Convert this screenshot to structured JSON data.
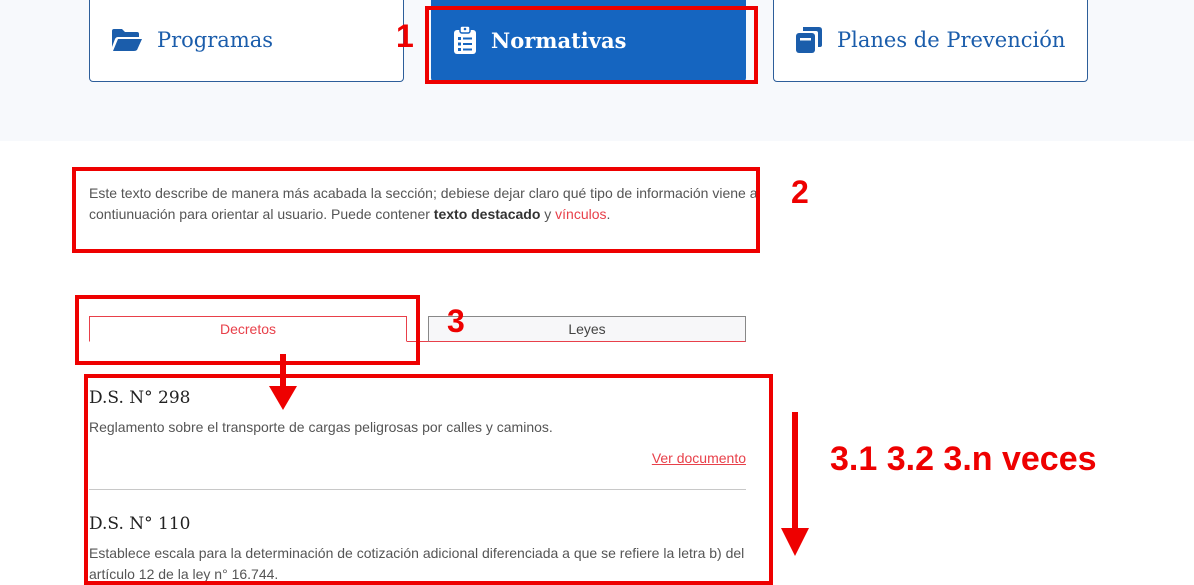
{
  "nav": {
    "items": [
      {
        "label": "Programas",
        "icon": "folder-open-icon"
      },
      {
        "label": "Normativas",
        "icon": "clipboard-list-icon",
        "active": true
      },
      {
        "label": "Planes de Prevención",
        "icon": "copy-icon"
      }
    ]
  },
  "intro": {
    "text_before": "Este texto describe de manera más acabada la sección; debiese dejar claro qué tipo de información viene a contiunuación para orientar al usuario. Puede contener ",
    "strong": "texto destacado",
    "text_middle": " y ",
    "link": "vínculos",
    "text_after": "."
  },
  "tabs": [
    {
      "label": "Decretos",
      "active": true
    },
    {
      "label": "Leyes",
      "active": false
    }
  ],
  "documents": [
    {
      "title": "D.S. N° 298",
      "description": "Reglamento sobre el transporte de cargas peligrosas por calles y caminos.",
      "link": "Ver documento"
    },
    {
      "title": "D.S. N° 110",
      "description": "Establece escala para la determinación de cotización adicional diferenciada a que se refiere la letra b) del artículo 12 de la ley n° 16.744."
    }
  ],
  "annotations": {
    "n1": "1",
    "n2": "2",
    "n3": "3",
    "repeat": "3.1 3.2 3.n veces",
    "color": "#ee0000"
  },
  "colors": {
    "primary_blue": "#1565c0",
    "accent_red": "#e8404a",
    "band_bg": "#f7f9fc"
  }
}
